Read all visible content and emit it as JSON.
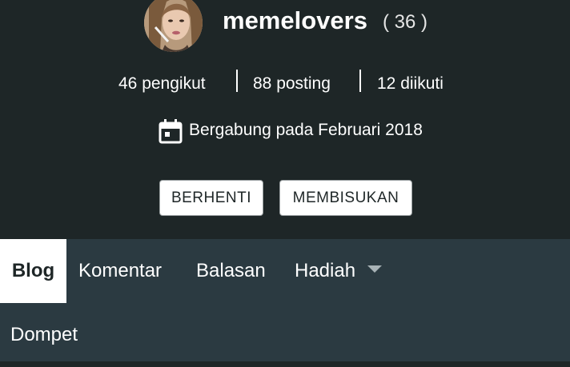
{
  "profile": {
    "username": "memelovers",
    "reputation": "( 36 )",
    "avatar_icon": "user-avatar-photo"
  },
  "stats": {
    "followers": "46 pengikut",
    "posts": "88 posting",
    "following": "12 diikuti"
  },
  "joined": {
    "icon": "calendar-icon",
    "text": "Bergabung pada Februari 2018"
  },
  "actions": {
    "stop_label": "BERHENTI",
    "mute_label": "MEMBISUKAN"
  },
  "tabs": [
    {
      "label": "Blog",
      "active": true
    },
    {
      "label": "Komentar",
      "active": false
    },
    {
      "label": "Balasan",
      "active": false
    },
    {
      "label": "Hadiah",
      "active": false,
      "has_dropdown": true
    },
    {
      "label": "Dompet",
      "active": false
    }
  ],
  "colors": {
    "header_bg": "#1e2627",
    "tabs_bg": "#2b3a41",
    "active_tab_bg": "#ffffff",
    "button_bg": "#ffffff",
    "text": "#ffffff"
  }
}
